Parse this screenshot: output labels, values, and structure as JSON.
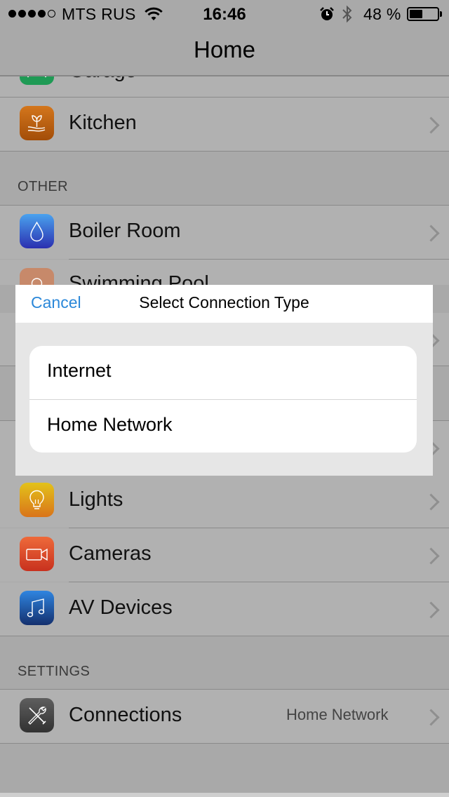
{
  "status_bar": {
    "signal_dots": [
      true,
      true,
      true,
      true,
      false
    ],
    "carrier": "MTS RUS",
    "wifi_icon": "wifi-icon",
    "time": "16:46",
    "alarm_icon": "alarm-icon",
    "bluetooth_icon": "bluetooth-icon",
    "battery_percent": "48 %",
    "battery_level": 0.48
  },
  "nav": {
    "title": "Home"
  },
  "list": {
    "rows_top": [
      {
        "label": "Garage",
        "icon": "garage-icon",
        "color": "#1f9a55"
      },
      {
        "label": "Kitchen",
        "icon": "plant-icon",
        "color": "#c8650f"
      }
    ],
    "sections": [
      {
        "header": "OTHER",
        "rows": [
          {
            "label": "Boiler Room",
            "icon": "water-drop-icon",
            "color": "#2a7fd6"
          },
          {
            "label": "Swimming Pool",
            "icon": "pool-icon",
            "color": "#c7896a"
          }
        ]
      }
    ],
    "rows_bottom": [
      {
        "label": "Lights",
        "icon": "light-bulb-icon",
        "color": "#d6a21a"
      },
      {
        "label": "Cameras",
        "icon": "video-camera-icon",
        "color": "#d44a2a"
      },
      {
        "label": "AV Devices",
        "icon": "music-note-icon",
        "color": "#1d5fb8"
      }
    ],
    "settings": {
      "header": "SETTINGS",
      "rows": [
        {
          "label": "Connections",
          "icon": "tools-icon",
          "color": "#4a4a4a",
          "detail": "Home Network"
        }
      ]
    }
  },
  "modal": {
    "cancel_label": "Cancel",
    "title": "Select Connection Type",
    "options": [
      "Internet",
      "Home Network"
    ]
  }
}
